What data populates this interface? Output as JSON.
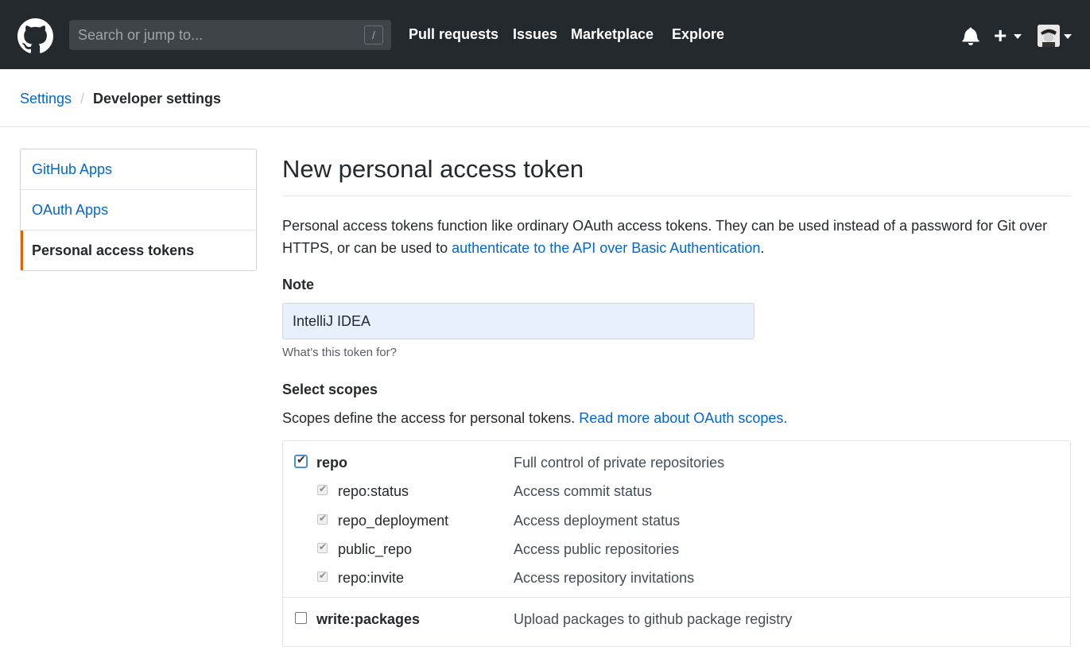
{
  "header": {
    "search_placeholder": "Search or jump to...",
    "search_shortcut": "/",
    "nav": [
      "Pull requests",
      "Issues",
      "Marketplace",
      "Explore"
    ],
    "plus": "+"
  },
  "breadcrumb": {
    "parent": "Settings",
    "separator": "/",
    "current": "Developer settings"
  },
  "sidebar": {
    "items": [
      {
        "label": "GitHub Apps"
      },
      {
        "label": "OAuth Apps"
      },
      {
        "label": "Personal access tokens",
        "selected": true
      }
    ]
  },
  "main": {
    "title": "New personal access token",
    "intro_text": "Personal access tokens function like ordinary OAuth access tokens. They can be used instead of a password for Git over HTTPS, or can be used to ",
    "intro_link": "authenticate to the API over Basic Authentication",
    "intro_end": ".",
    "note_label": "Note",
    "note_value": "IntelliJ IDEA",
    "note_help": "What’s this token for?",
    "scopes_label": "Select scopes",
    "scopes_desc": "Scopes define the access for personal tokens. ",
    "scopes_link": "Read more about OAuth scopes."
  },
  "scopes": [
    {
      "name": "repo",
      "desc": "Full control of private repositories",
      "checked": true,
      "level": "main"
    },
    {
      "name": "repo:status",
      "desc": "Access commit status",
      "checked": true,
      "level": "sub"
    },
    {
      "name": "repo_deployment",
      "desc": "Access deployment status",
      "checked": true,
      "level": "sub"
    },
    {
      "name": "public_repo",
      "desc": "Access public repositories",
      "checked": true,
      "level": "sub"
    },
    {
      "name": "repo:invite",
      "desc": "Access repository invitations",
      "checked": true,
      "level": "sub"
    },
    {
      "name": "write:packages",
      "desc": "Upload packages to github package registry",
      "checked": false,
      "level": "main"
    }
  ],
  "colors": {
    "header_bg": "#24292e",
    "link": "#0366d6",
    "selected_accent": "#e36209",
    "input_bg": "#e8f0fe"
  }
}
